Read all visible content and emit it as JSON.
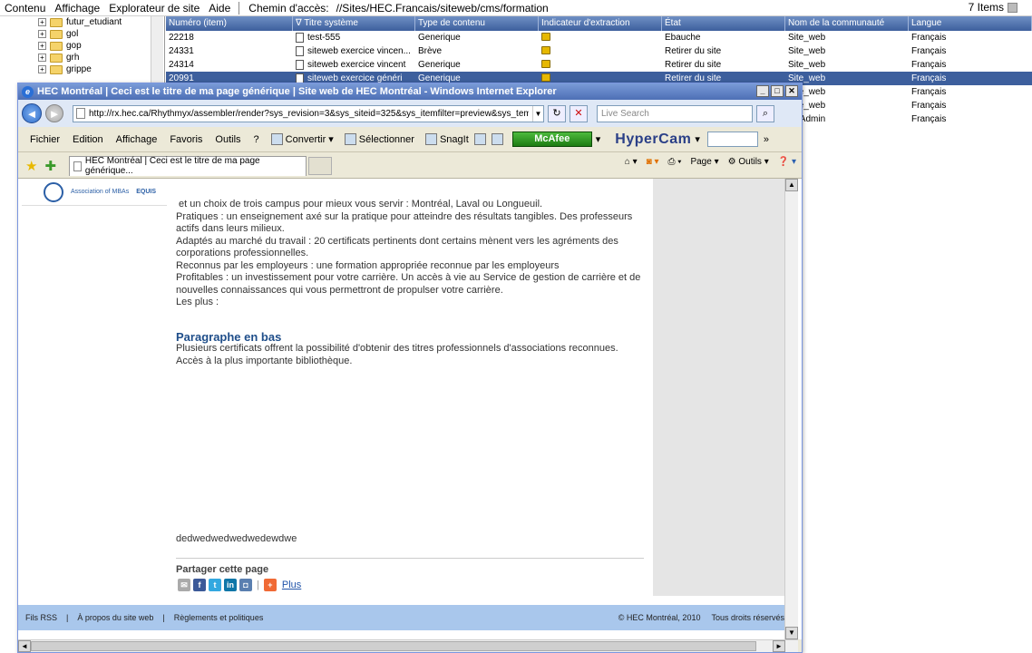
{
  "bg_app": {
    "menu": [
      "Contenu",
      "Affichage",
      "Explorateur de site",
      "Aide"
    ],
    "path_label": "Chemin d'accès:",
    "path_value": "//Sites/HEC.Francais/siteweb/cms/formation",
    "items_count": "7 Items",
    "tree": [
      "futur_etudiant",
      "gol",
      "gop",
      "grh",
      "grippe"
    ],
    "columns": [
      "Numéro (item)",
      "∇ Titre système",
      "Type de contenu",
      "Indicateur d'extraction",
      "État",
      "Nom de la communauté",
      "Langue"
    ],
    "rows": [
      {
        "id": "22218",
        "title": "test-555",
        "type": "Generique",
        "state": "Ébauche",
        "community": "Site_web",
        "lang": "Français"
      },
      {
        "id": "24331",
        "title": "siteweb exercice vincen...",
        "type": "Brève",
        "state": "Retirer du site",
        "community": "Site_web",
        "lang": "Français"
      },
      {
        "id": "24314",
        "title": "siteweb exercice vincent",
        "type": "Generique",
        "state": "Retirer du site",
        "community": "Site_web",
        "lang": "Français"
      },
      {
        "id": "20991",
        "title": "siteweb exercice généri",
        "type": "Generique",
        "state": "Retirer du site",
        "community": "Site_web",
        "lang": "Français"
      },
      {
        "id": "",
        "title": "",
        "type": "",
        "state": "",
        "community": "Site_web",
        "lang": "Français"
      },
      {
        "id": "",
        "title": "",
        "type": "",
        "state": "",
        "community": "Site_web",
        "lang": "Français"
      },
      {
        "id": "",
        "title": "",
        "type": "",
        "state": "",
        "community": "C_Admin",
        "lang": "Français"
      }
    ]
  },
  "ie": {
    "title": "HEC Montréal | Ceci est le titre de ma page générique | Site web de HEC Montréal - Windows Internet Explorer",
    "url": "http://rx.hec.ca/Rhythmyx/assembler/render?sys_revision=3&sys_siteid=325&sys_itemfilter=preview&sys_temp",
    "search_placeholder": "Live Search",
    "menu": [
      "Fichier",
      "Edition",
      "Affichage",
      "Favoris",
      "Outils",
      "?"
    ],
    "toolbar": {
      "convert": "Convertir",
      "select": "Sélectionner",
      "snagit": "SnagIt",
      "mcafee": "McAfee",
      "hypercam": "HyperCam"
    },
    "tab_title": "HEC Montréal | Ceci est le titre de ma page générique...",
    "cmd": {
      "page": "Page",
      "tools": "Outils"
    }
  },
  "page": {
    "logo_text": "Association of MBAs",
    "logo_text2": "EQUIS",
    "p1": "et un choix de trois campus pour mieux vous servir : Montréal, Laval ou Longueuil.",
    "p2": "Pratiques : un enseignement axé sur la pratique pour atteindre des résultats tangibles. Des professeurs actifs dans leurs milieux.",
    "p3": "Adaptés au marché du travail : 20 certificats pertinents dont certains mènent vers les agréments des corporations professionnelles.",
    "p4": "Reconnus par les employeurs : une formation appropriée reconnue par les employeurs",
    "p5": "Profitables : un investissement pour votre carrière. Un accès à vie au Service de gestion de carrière et de nouvelles connaissances qui vous permettront de propulser votre carrière.",
    "p6": "Les plus :",
    "h2": "Paragraphe en bas",
    "para_bottom": "Plusieurs certificats offrent la possibilité d'obtenir des titres professionnels d'associations reconnues. Accès à la plus importante bibliothèque.",
    "dummy": "dedwedwedwedwedewdwe",
    "share_title": "Partager cette page",
    "share_plus": "Plus",
    "footer": {
      "rss": "Fils RSS",
      "about": "À propos du site web",
      "rules": "Règlements et politiques",
      "copyright": "© HEC Montréal, 2010",
      "rights": "Tous droits réservés"
    }
  }
}
